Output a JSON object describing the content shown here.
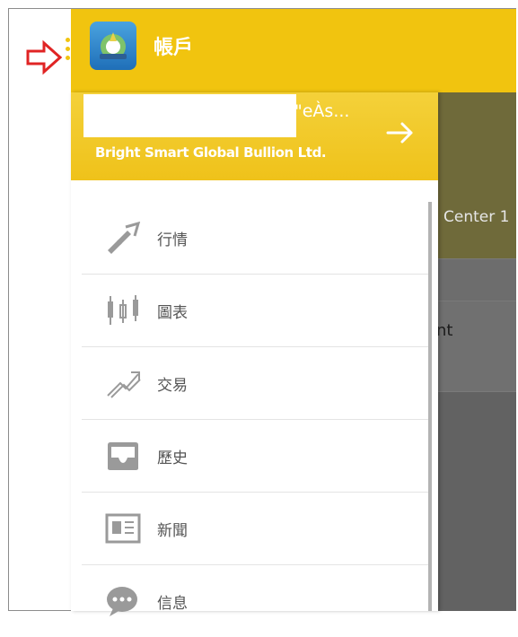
{
  "app_bar": {
    "title": "帳戶",
    "logo_icon": "metatrader-logo-icon"
  },
  "drawer": {
    "account_suffix": "\"eÀs...",
    "broker": "Bright Smart Global Bullion Ltd.",
    "menu": [
      {
        "label": "行情",
        "icon": "quotes-icon"
      },
      {
        "label": "圖表",
        "icon": "candlestick-chart-icon"
      },
      {
        "label": "交易",
        "icon": "trade-icon"
      },
      {
        "label": "歷史",
        "icon": "history-inbox-icon"
      },
      {
        "label": "新聞",
        "icon": "news-icon"
      },
      {
        "label": "信息",
        "icon": "message-bubble-icon"
      }
    ]
  },
  "background": {
    "text_a": "Center 1",
    "text_b": "nt"
  },
  "colors": {
    "accent": "#f1c40f",
    "callout": "#e02424",
    "icon_gray": "#9a9a9a"
  }
}
